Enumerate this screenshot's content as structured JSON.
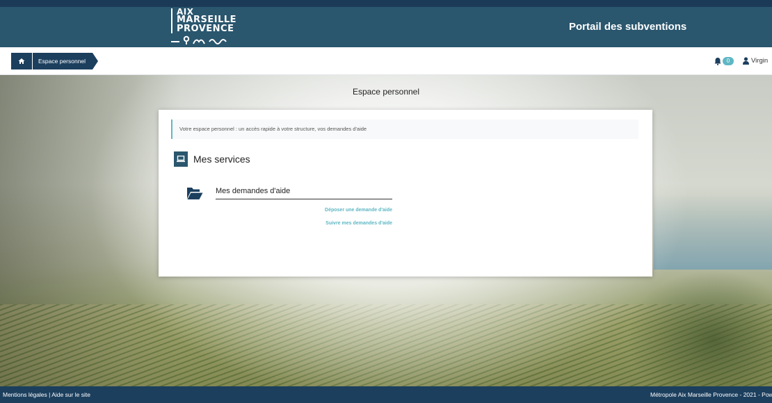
{
  "header": {
    "logo": {
      "line1": "AIX",
      "line2": "MARSEILLE",
      "line3": "PROVENCE"
    },
    "portal_title": "Portail des subventions",
    "color": "#2a566e"
  },
  "breadcrumb": {
    "home_icon": "home-icon",
    "current": "Espace personnel"
  },
  "topbar_right": {
    "notification_icon": "bell-icon",
    "notification_count": "0",
    "user_icon": "user-icon",
    "user_name": "Virgin"
  },
  "page": {
    "title": "Espace personnel",
    "info": "Votre espace personnel : un accès rapide à votre structure, vos demandes d'aide",
    "services_title": "Mes services",
    "services_icon": "laptop-icon",
    "demandes": {
      "icon": "folder-open-icon",
      "title": "Mes demandes d'aide",
      "links": [
        "Déposer une demande d'aide",
        "Suivre mes demandes d'aide"
      ]
    }
  },
  "footer": {
    "left": "Mentions légales | Aide sur le site",
    "right": "Métropole Aix Marseille Provence - 2021 - Pow"
  },
  "colors": {
    "accent": "#5fb7c4",
    "dark": "#1c3f5e"
  }
}
